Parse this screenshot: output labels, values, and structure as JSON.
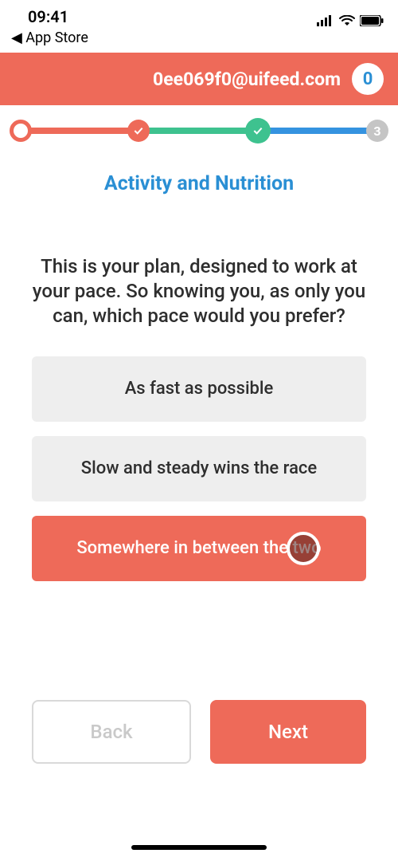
{
  "status": {
    "time": "09:41",
    "back_label": "◀ App Store"
  },
  "header": {
    "email": "0ee069f0@uifeed.com",
    "badge": "0"
  },
  "stepper": {
    "section_title": "Activity and Nutrition",
    "step3_label": "3"
  },
  "question": "This is your plan, designed to work at your pace. So knowing you, as only you can, which pace would you prefer?",
  "options": [
    {
      "label": "As fast as possible",
      "selected": false
    },
    {
      "label": "Slow and steady wins the race",
      "selected": false
    },
    {
      "label": "Somewhere in between the two",
      "selected": true
    }
  ],
  "footer": {
    "back": "Back",
    "next": "Next"
  },
  "colors": {
    "accent": "#ee6a59",
    "link_blue": "#2a8fd4",
    "progress_green": "#3ec28f",
    "progress_blue": "#3593e0"
  }
}
